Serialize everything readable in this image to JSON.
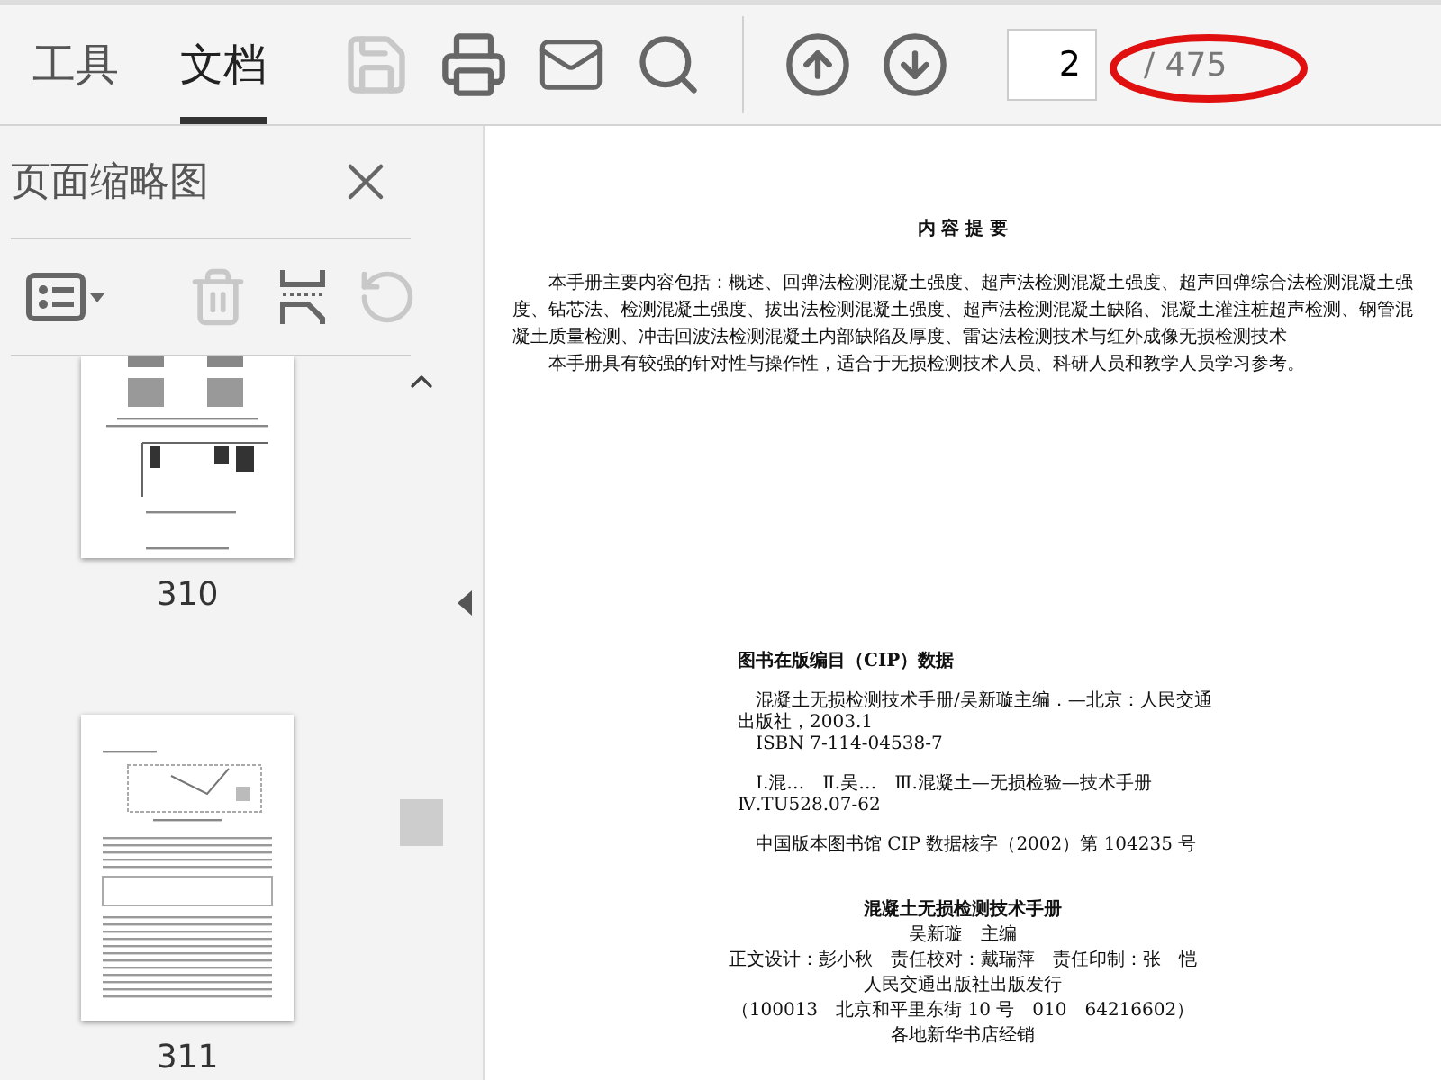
{
  "toolbar": {
    "tabs": [
      {
        "label": "工具",
        "selected": false
      },
      {
        "label": "文档",
        "selected": true
      }
    ],
    "buttons": [
      {
        "kind": "save",
        "disabled": true
      },
      {
        "kind": "print",
        "disabled": false
      },
      {
        "kind": "mail",
        "disabled": false
      },
      {
        "kind": "search",
        "disabled": false
      },
      {
        "kind": "separator"
      },
      {
        "kind": "prev",
        "disabled": false
      },
      {
        "kind": "next",
        "disabled": false
      }
    ],
    "page_input": {
      "value": "2"
    },
    "page_total": "/ 475",
    "page_total_circled": true
  },
  "sidebar": {
    "title": "页面缩略图",
    "tools": [
      {
        "kind": "options",
        "disabled": false
      },
      {
        "kind": "separator"
      },
      {
        "kind": "delete",
        "disabled": true
      },
      {
        "kind": "extract",
        "disabled": false
      },
      {
        "kind": "rotate",
        "disabled": true
      }
    ],
    "thumbnails": [
      {
        "label": "310",
        "kind": "figure",
        "cut": true
      },
      {
        "label": "311",
        "kind": "text",
        "cut": false
      }
    ]
  },
  "document": {
    "heading": "内 容 提 要",
    "abstract": [
      "本手册主要内容包括：概述、回弹法检测混凝土强度、超声法检测混凝土强度、超声回弹综合法检测混凝土强度、钻芯法、检测混凝土强度、拔出法检测混凝土强度、超声法检测混凝土缺陷、混凝土灌注桩超声检测、钢管混凝土质量检测、冲击回波法检测混凝土内部缺陷及厚度、雷达法检测技术与红外成像无损检测技术",
      "本手册具有较强的针对性与操作性，适合于无损检测技术人员、科研人员和教学人员学习参考。"
    ],
    "cip_title": "图书在版编目（CIP）数据",
    "cip_lines": [
      "混凝土无损检测技术手册/吴新璇主编．—北京：人民交通出版社，2003.1",
      "ISBN 7-114-04538-7",
      "Ⅰ.混…　Ⅱ.吴…　Ⅲ.混凝土—无损检验—技术手册　Ⅳ.TU528.07-62",
      "中国版本图书馆 CIP 数据核字（2002）第 104235 号"
    ],
    "book_title": "混凝土无损检测技术手册",
    "credits": [
      "吴新璇　主编",
      "正文设计：彭小秋　责任校对：戴瑞萍　责任印制：张　恺",
      "人民交通出版社出版发行",
      "（100013　北京和平里东街 10 号　010　64216602）",
      "各地新华书店经销"
    ]
  }
}
